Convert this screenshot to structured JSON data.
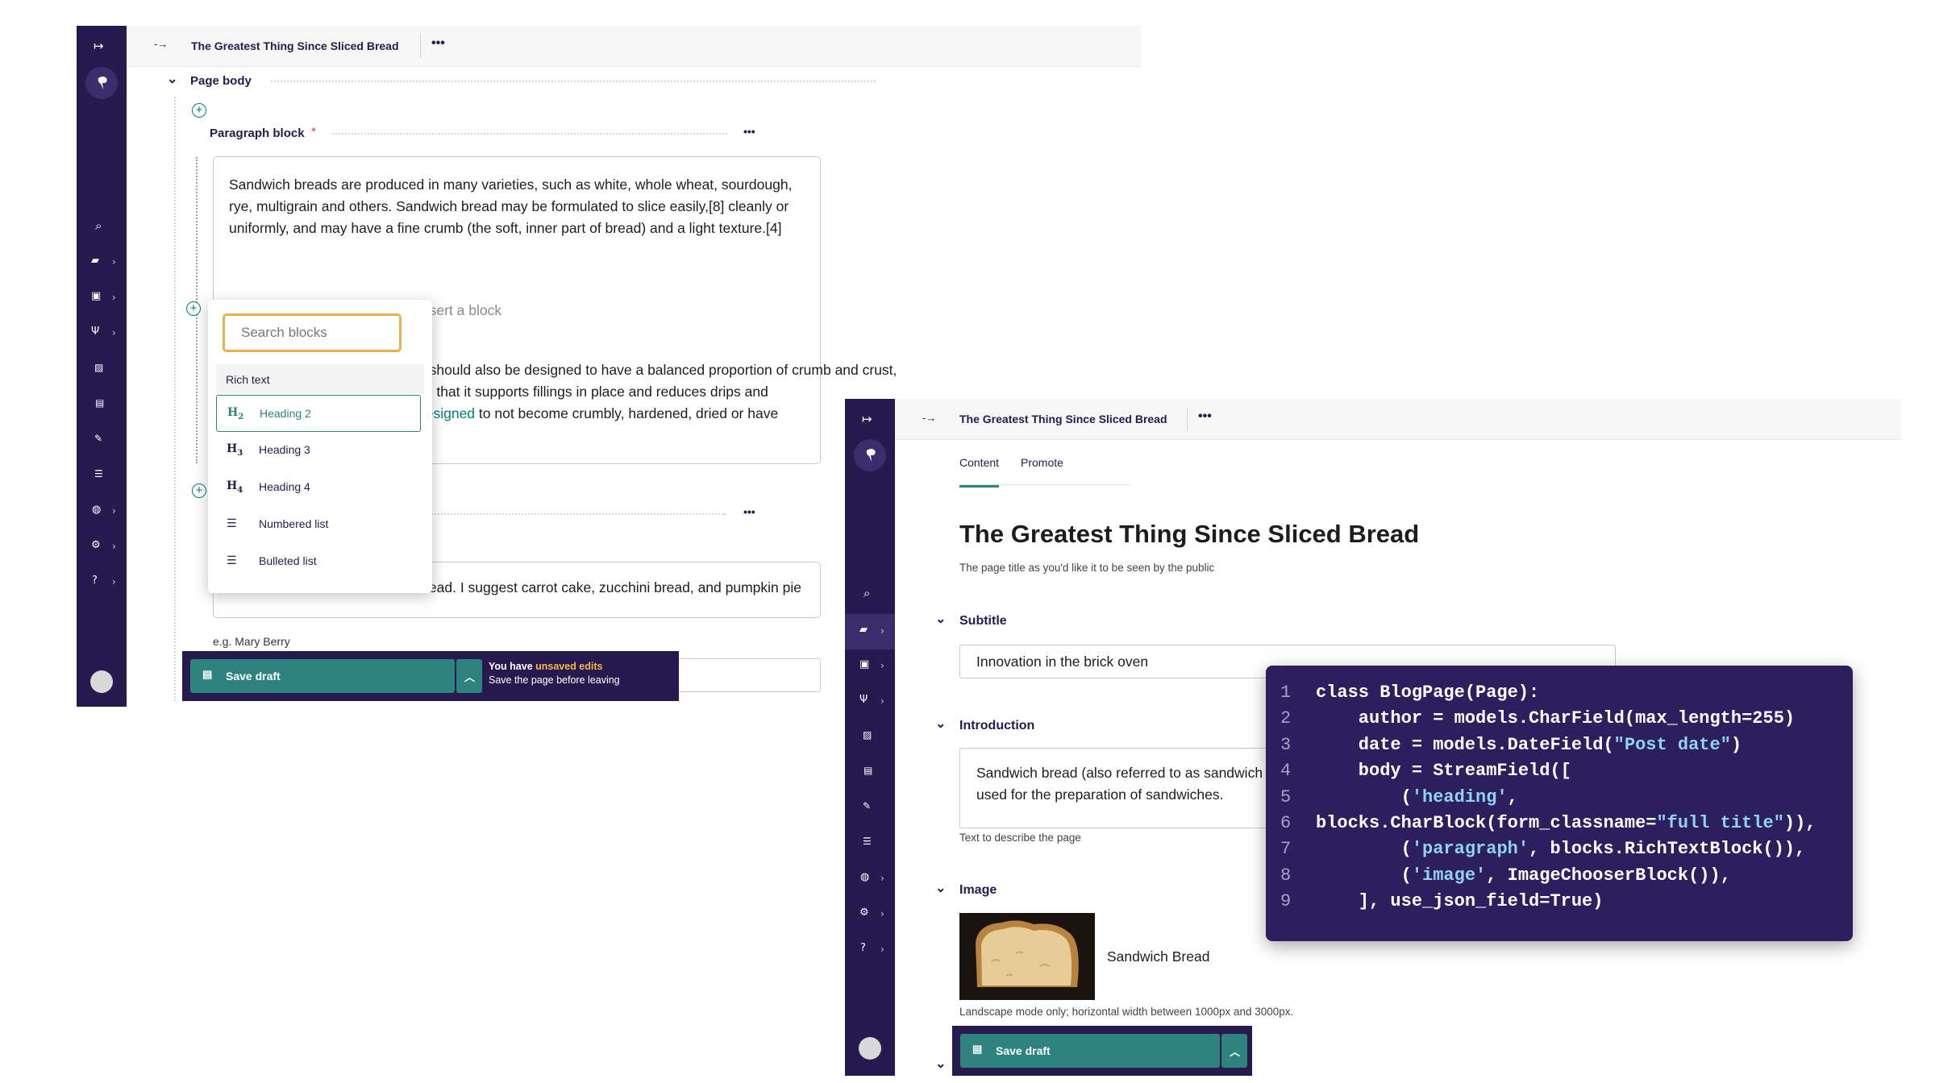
{
  "colors": {
    "sidebar": "#261a4f",
    "accent_teal": "#2e8380",
    "search_border": "#e9b04d",
    "warning_text": "#f5b84a",
    "code_bg": "#2d1f5e",
    "code_string": "#8fd3ee"
  },
  "left_editor": {
    "breadcrumb": "The Greatest Thing Since Sliced Bread",
    "more_label": "•••",
    "section_label": "Page body",
    "paragraph_block_label": "Paragraph block",
    "required_marker": "*",
    "paragraph_text": "Sandwich breads are produced in many varieties, such as white, whole wheat, sourdough, rye, multigrain and others. Sandwich bread may be formulated to slice easily,[8] cleanly or uniformly, and may have a fine crumb (the soft, inner part of bread) and a light texture.[4]",
    "insert_hint": "Insert a block",
    "para2_line1": "It should also be designed to have a balanced proportion of crumb and crust,",
    "para2_line2": "so that it supports fillings in place and reduces drips and",
    "para2_line3_link": "designed",
    "para2_line3_rest": " to not become crumbly, hardened, dried or have",
    "second_input_text": "Other favourite breads include banana bread. I suggest carrot cake, zucchini bread, and pumpkin pie.",
    "author_placeholder": "e.g. Mary Berry",
    "block_chooser": {
      "search_placeholder": "Search blocks",
      "group_label": "Rich text",
      "items": [
        {
          "icon": "H2",
          "label": "Heading 2"
        },
        {
          "icon": "H3",
          "label": "Heading 3"
        },
        {
          "icon": "H4",
          "label": "Heading 4"
        },
        {
          "icon": "list-ol",
          "label": "Numbered list"
        },
        {
          "icon": "list-ul",
          "label": "Bulleted list"
        }
      ]
    },
    "save": {
      "button_label": "Save draft",
      "warning_prefix": "You have ",
      "warning_highlight": "unsaved edits",
      "warning_sub": "Save the page before leaving"
    }
  },
  "right_editor": {
    "breadcrumb": "The Greatest Thing Since Sliced Bread",
    "more_label": "•••",
    "tabs": [
      {
        "label": "Content",
        "active": true
      },
      {
        "label": "Promote",
        "active": false
      }
    ],
    "page_title": "The Greatest Thing Since Sliced Bread",
    "title_help": "The page title as you'd like it to be seen by the public",
    "subtitle_label": "Subtitle",
    "subtitle_value": "Innovation in the brick oven",
    "intro_label": "Introduction",
    "intro_value_line1": "Sandwich bread (also referred to as sandwich loaf) is a bread that is prepared specifically to be",
    "intro_value_line2": "used for the preparation of sandwiches.",
    "intro_help": "Text to describe the page",
    "image_label": "Image",
    "image_title": "Sandwich Bread",
    "image_help": "Landscape mode only; horizontal width between 1000px and 3000px.",
    "save": {
      "button_label": "Save draft"
    }
  },
  "code": {
    "lines": [
      {
        "n": "1",
        "parts": [
          {
            "t": "class BlogPage(Page):",
            "s": false
          }
        ]
      },
      {
        "n": "2",
        "parts": [
          {
            "t": "    author = models.CharField(max_length=255)",
            "s": false
          }
        ]
      },
      {
        "n": "3",
        "parts": [
          {
            "t": "    date = models.DateField(",
            "s": false
          },
          {
            "t": "\"Post date\"",
            "s": true
          },
          {
            "t": ")",
            "s": false
          }
        ]
      },
      {
        "n": "4",
        "parts": [
          {
            "t": "    body = StreamField([",
            "s": false
          }
        ]
      },
      {
        "n": "5",
        "parts": [
          {
            "t": "        (",
            "s": false
          },
          {
            "t": "'heading'",
            "s": true
          },
          {
            "t": ",",
            "s": false
          }
        ]
      },
      {
        "n": "6",
        "parts": [
          {
            "t": "blocks.CharBlock(form_classname=",
            "s": false
          },
          {
            "t": "\"full title\"",
            "s": true
          },
          {
            "t": ")),",
            "s": false
          }
        ]
      },
      {
        "n": "7",
        "parts": [
          {
            "t": "        (",
            "s": false
          },
          {
            "t": "'paragraph'",
            "s": true
          },
          {
            "t": ", blocks.RichTextBlock()),",
            "s": false
          }
        ]
      },
      {
        "n": "8",
        "parts": [
          {
            "t": "        (",
            "s": false
          },
          {
            "t": "'image'",
            "s": true
          },
          {
            "t": ", ImageChooserBlock()),",
            "s": false
          }
        ]
      },
      {
        "n": "9",
        "parts": [
          {
            "t": "    ], use_json_field=True)",
            "s": false
          }
        ]
      }
    ]
  }
}
